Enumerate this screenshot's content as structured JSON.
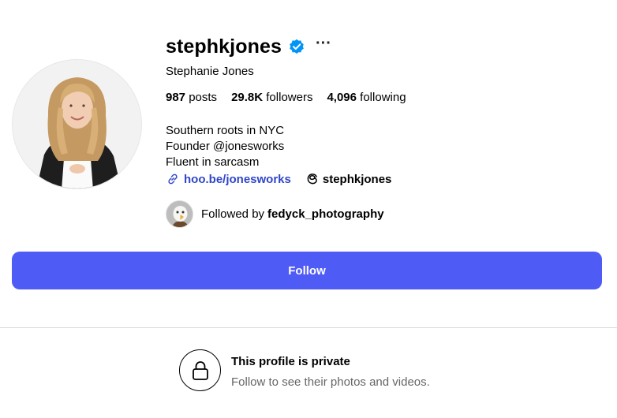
{
  "profile": {
    "username": "stephkjones",
    "verified_icon": "verified-badge-icon",
    "more_label": "···",
    "full_name": "Stephanie Jones",
    "stats": {
      "posts_count": "987",
      "posts_label": "posts",
      "followers_count": "29.8K",
      "followers_label": "followers",
      "following_count": "4,096",
      "following_label": "following"
    },
    "bio": [
      "Southern roots in NYC",
      "Founder @jonesworks",
      "Fluent in sarcasm"
    ],
    "link_text": "hoo.be/jonesworks",
    "threads_handle": "stephkjones",
    "followed_by_prefix": "Followed by",
    "followed_by_user": "fedyck_photography"
  },
  "actions": {
    "follow_label": "Follow"
  },
  "private": {
    "title": "This profile is private",
    "subtitle": "Follow to see their photos and videos."
  },
  "colors": {
    "accent": "#4f5bf5",
    "link": "#3046c8",
    "verified": "#0095f6"
  }
}
